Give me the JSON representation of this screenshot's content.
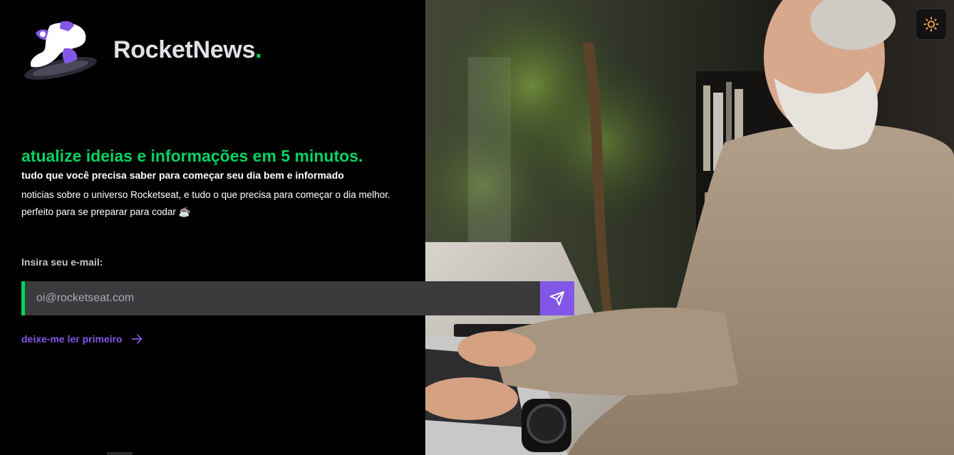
{
  "brand": {
    "name": "RocketNews",
    "dot": ".",
    "logo_icon": "rocket-mascot-logo"
  },
  "hero": {
    "headline": "atualize ideias e informações em 5 minutos.",
    "subheadline": "tudo que você precisa saber para começar seu dia bem e informado",
    "description_line1": "noticias sobre o universo Rocketseat, e tudo o que precisa para começar o dia melhor.",
    "description_line2": "perfeito para se preparar para codar ☕"
  },
  "form": {
    "label": "Insira seu e-mail:",
    "email_placeholder": "oi@rocketseat.com",
    "email_value": "",
    "submit_icon": "send-icon"
  },
  "read_first": {
    "label": "deixe-me ler primeiro",
    "icon": "arrow-right-icon"
  },
  "theme_toggle": {
    "icon": "sun-icon"
  },
  "colors": {
    "accent_green": "#04d361",
    "accent_purple": "#8257e5",
    "background": "#000000",
    "input_bg": "#3b3b3e",
    "sun": "#fba94c"
  }
}
